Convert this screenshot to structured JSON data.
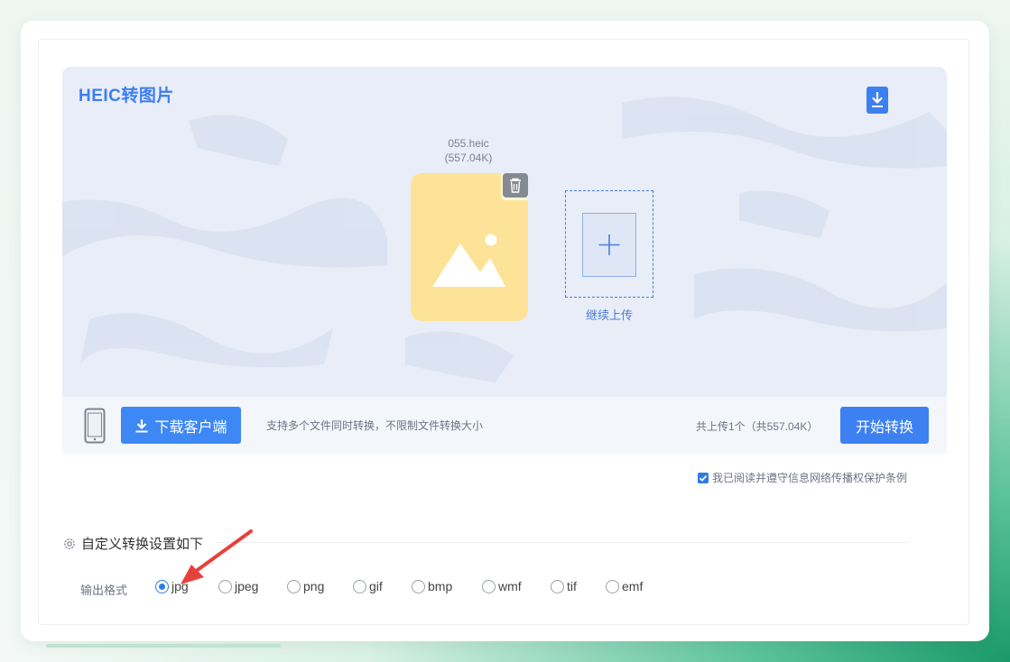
{
  "tool": {
    "title": "HEIC转图片"
  },
  "file": {
    "name": "055.heic",
    "size": "(557.04K)"
  },
  "upload": {
    "add_label": "继续上传"
  },
  "bottom": {
    "client_button": "下载客户端",
    "support_text": "支持多个文件同时转换，不限制文件转换大小",
    "count_text": "共上传1个（共557.04K）",
    "start_button": "开始转换"
  },
  "agree": {
    "text": "我已阅读并遵守信息网络传播权保护条例",
    "checked": true
  },
  "settings": {
    "title": "自定义转换设置如下"
  },
  "format": {
    "label": "输出格式",
    "options": [
      "jpg",
      "jpeg",
      "png",
      "gif",
      "bmp",
      "wmf",
      "tif",
      "emf"
    ],
    "selected": "jpg"
  },
  "colors": {
    "accent": "#3d80f2",
    "file_icon": "#fde397",
    "annotation_arrow": "#e8403a"
  }
}
